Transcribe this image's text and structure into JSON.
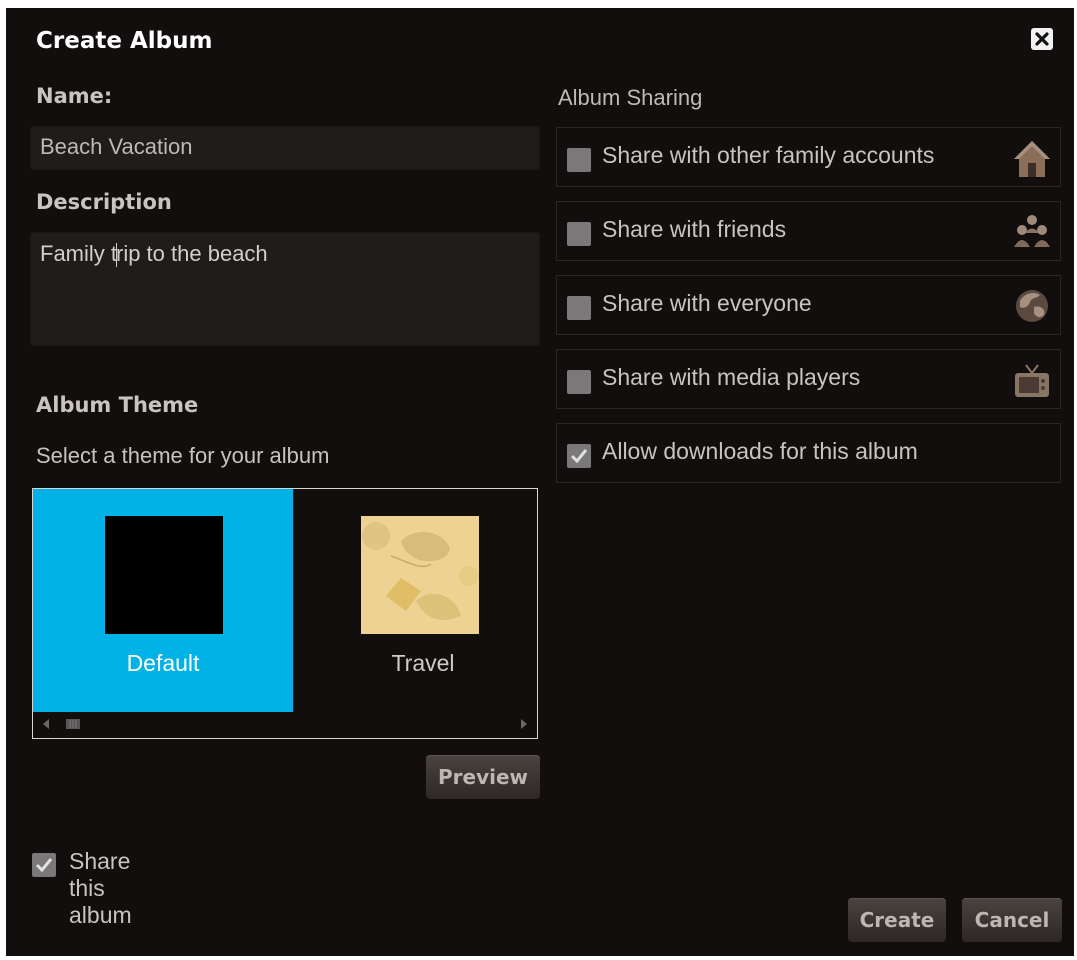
{
  "dialog": {
    "title": "Create Album"
  },
  "name_field": {
    "label": "Name:",
    "value": "Beach Vacation"
  },
  "description_field": {
    "label": "Description",
    "value_before_caret": "Family t",
    "value_after_caret": "rip to the beach"
  },
  "theme": {
    "heading": "Album Theme",
    "subtitle": "Select a theme for your album",
    "options": [
      {
        "label": "Default",
        "selected": true
      },
      {
        "label": "Travel",
        "selected": false
      }
    ],
    "preview_label": "Preview"
  },
  "sharing": {
    "heading": "Album Sharing",
    "options": [
      {
        "label": "Share with other family accounts",
        "checked": false,
        "icon": "house-icon"
      },
      {
        "label": "Share with friends",
        "checked": false,
        "icon": "people-icon"
      },
      {
        "label": "Share with everyone",
        "checked": false,
        "icon": "globe-icon"
      },
      {
        "label": "Share with media players",
        "checked": false,
        "icon": "tv-icon"
      },
      {
        "label": "Allow downloads for this album",
        "checked": true,
        "icon": ""
      }
    ]
  },
  "share_album": {
    "label": "Share this album",
    "checked": true
  },
  "buttons": {
    "create": "Create",
    "cancel": "Cancel"
  },
  "colors": {
    "background": "#120e0e",
    "selected_theme": "#00b2e6",
    "button_top": "#4a4340",
    "button_bottom": "#2d2725"
  }
}
